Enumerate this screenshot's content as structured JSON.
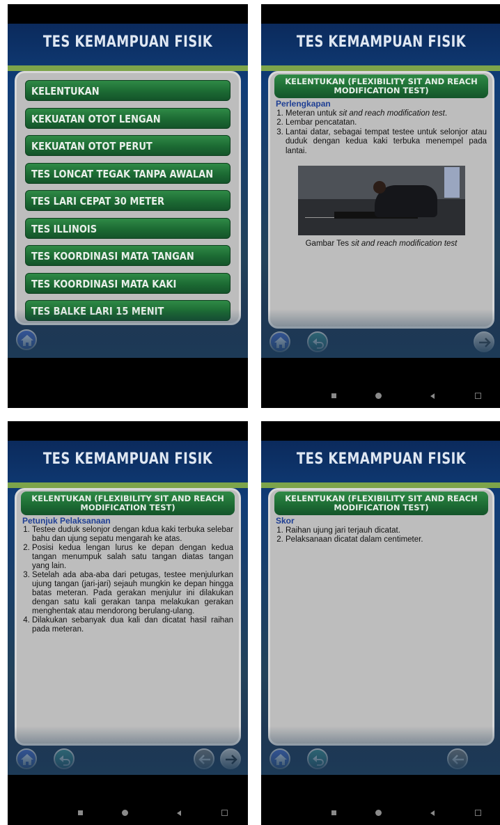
{
  "app_title": "TES KEMAMPUAN FISIK",
  "menu": {
    "items": [
      "KELENTUKAN",
      "KEKUATAN OTOT LENGAN",
      "KEKUATAN OTOT PERUT",
      "TES LONCAT TEGAK TANPA AWALAN",
      "TES LARI CEPAT 30 METER",
      "TES ILLINOIS",
      "TES KOORDINASI MATA TANGAN",
      "TES KOORDINASI MATA KAKI",
      "TES BALKE LARI 15 MENIT"
    ]
  },
  "detail_header": "KELENTUKAN (FLEXIBILITY SIT AND REACH MODIFICATION TEST)",
  "equipment": {
    "heading": "Perlengkapan",
    "items": [
      {
        "pre": "Meteran untuk ",
        "em": "sit and reach modification test",
        "post": "."
      },
      {
        "pre": "Lembar pencatatan.",
        "em": "",
        "post": ""
      },
      {
        "pre": "Lantai datar, sebagai tempat testee untuk selonjor atau duduk dengan kedua kaki terbuka menempel pada lantai.",
        "em": "",
        "post": ""
      }
    ],
    "caption_pre": "Gambar Tes ",
    "caption_em": "sit and reach modification test"
  },
  "instructions": {
    "heading": "Petunjuk Pelaksanaan",
    "items": [
      "Testee duduk selonjor dengan kdua kaki terbuka selebar bahu dan ujung sepatu mengarah ke atas.",
      "Posisi kedua lengan lurus ke depan dengan kedua tangan menumpuk salah satu tangan diatas tangan yang lain.",
      "Setelah ada aba-aba dari petugas, testee menjulurkan ujung tangan (jari-jari) sejauh mungkin ke depan hingga batas meteran. Pada gerakan menjulur ini dilakukan dengan satu kali gerakan tanpa melakukan gerakan menghentak atau mendorong berulang-ulang.",
      "Dilakukan sebanyak dua kali dan dicatat hasil raihan pada meteran."
    ]
  },
  "score": {
    "heading": "Skor",
    "items": [
      "Raihan ujung jari terjauh dicatat.",
      "Pelaksanaan dicatat dalam centimeter."
    ]
  },
  "icons": {
    "home": "home-icon",
    "back": "back-icon",
    "prev": "arrow-left-icon",
    "next": "arrow-right-icon"
  },
  "colors": {
    "menu_button": "#1c6a33",
    "heading_text": "#1f3f94",
    "panel": "#bdbdbd",
    "home_button": "#4769c9",
    "back_button": "#3b8a8c"
  }
}
